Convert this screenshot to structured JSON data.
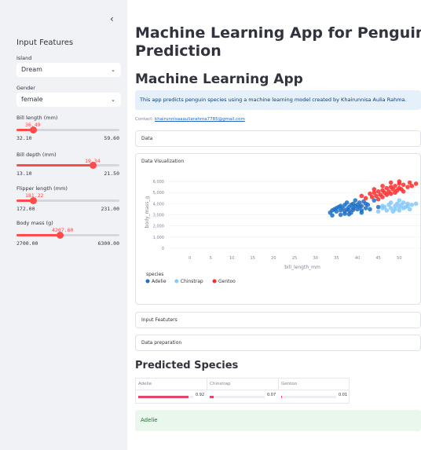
{
  "sidebar": {
    "collapse_glyph": "‹",
    "title": "Input Features",
    "island_label": "Island",
    "island_value": "Dream",
    "gender_label": "Gender",
    "gender_value": "female",
    "sliders": [
      {
        "label": "Bill length (mm)",
        "value": "36.49",
        "min": "32.10",
        "max": "59.60",
        "fraction": 0.16
      },
      {
        "label": "Bill depth (mm)",
        "value": "19.34",
        "min": "13.10",
        "max": "21.50",
        "fraction": 0.74
      },
      {
        "label": "Flipper length (mm)",
        "value": "181.22",
        "min": "172.00",
        "max": "231.00",
        "fraction": 0.16
      },
      {
        "label": "Body mass (g)",
        "value": "4207.60",
        "min": "2700.00",
        "max": "6300.00",
        "fraction": 0.42
      }
    ]
  },
  "main": {
    "title": "Machine Learning App for Penguin Species Prediction",
    "title_line1": "Machine Learning App for Penguin Spec",
    "title_line2": "Prediction",
    "subtitle": "Machine Learning App",
    "info_text": "This app predicts penguin species using a machine learning model created by Khairunnisa Aulia Rahma.",
    "contact_label": "Contact:",
    "contact_email": "khairunnisaaauliarahma7785@gmail.com",
    "expanders": {
      "data": "Data",
      "visualization": "Data Visualization",
      "input_features": "Input Featuters",
      "data_preparation": "Data preparation"
    },
    "predicted_heading": "Predicted Species",
    "probabilities": [
      {
        "species": "Adelie",
        "value": 0.92,
        "label": "0.92"
      },
      {
        "species": "Chinstrap",
        "value": 0.07,
        "label": "0.07"
      },
      {
        "species": "Gentoo",
        "value": 0.01,
        "label": "0.01"
      }
    ],
    "result": "Adelie"
  },
  "chart_data": {
    "type": "scatter",
    "xlabel": "bill_length_mm",
    "ylabel": "body_mass_g",
    "xlim": [
      -5,
      55
    ],
    "ylim": [
      0,
      6500
    ],
    "x_ticks": [
      "0",
      "5",
      "10",
      "15",
      "20",
      "25",
      "30",
      "35",
      "40",
      "45",
      "50"
    ],
    "y_ticks": [
      "0",
      "1,000",
      "2,000",
      "3,000",
      "4,000",
      "5,000",
      "6,000"
    ],
    "grid": true,
    "legend_title": "species",
    "legend_position": "bottom-left",
    "series": [
      {
        "name": "Adelie",
        "color": "#1f6fc5",
        "points": [
          [
            33.5,
            3200
          ],
          [
            34,
            3400
          ],
          [
            34.5,
            3500
          ],
          [
            35,
            3300
          ],
          [
            35,
            3600
          ],
          [
            35.5,
            3700
          ],
          [
            36,
            3400
          ],
          [
            36,
            3800
          ],
          [
            36.5,
            3600
          ],
          [
            37,
            3300
          ],
          [
            37,
            3900
          ],
          [
            37.5,
            3500
          ],
          [
            37.5,
            4100
          ],
          [
            38,
            3700
          ],
          [
            38,
            3400
          ],
          [
            38.5,
            3900
          ],
          [
            38.5,
            3200
          ],
          [
            39,
            3600
          ],
          [
            39,
            4000
          ],
          [
            39,
            3450
          ],
          [
            39.5,
            3800
          ],
          [
            39.5,
            4300
          ],
          [
            40,
            3500
          ],
          [
            40,
            3900
          ],
          [
            40.5,
            3700
          ],
          [
            40.5,
            4100
          ],
          [
            41,
            3400
          ],
          [
            41,
            3800
          ],
          [
            41.5,
            4200
          ],
          [
            42,
            3600
          ],
          [
            42,
            4000
          ],
          [
            42.5,
            3900
          ],
          [
            43,
            3500
          ],
          [
            44,
            4300
          ],
          [
            45,
            3700
          ],
          [
            36,
            3000
          ],
          [
            37,
            3100
          ],
          [
            34,
            2950
          ],
          [
            38,
            3050
          ],
          [
            41,
            3200
          ]
        ]
      },
      {
        "name": "Chinstrap",
        "color": "#83c9ff",
        "points": [
          [
            45,
            3300
          ],
          [
            46,
            3600
          ],
          [
            46.5,
            3700
          ],
          [
            47,
            3400
          ],
          [
            47.5,
            3900
          ],
          [
            48,
            3600
          ],
          [
            48.5,
            3300
          ],
          [
            49,
            3800
          ],
          [
            49,
            3500
          ],
          [
            49.5,
            4000
          ],
          [
            50,
            3700
          ],
          [
            50,
            3400
          ],
          [
            50.5,
            3900
          ],
          [
            51,
            3600
          ],
          [
            51,
            4100
          ],
          [
            51.5,
            3700
          ],
          [
            52,
            3800
          ],
          [
            52,
            4000
          ],
          [
            52.5,
            3500
          ],
          [
            53,
            3900
          ],
          [
            54,
            4000
          ],
          [
            55,
            3700
          ],
          [
            46,
            3800
          ],
          [
            48,
            4100
          ],
          [
            50,
            4300
          ]
        ]
      },
      {
        "name": "Gentoo",
        "color": "#ff2b2b",
        "points": [
          [
            41,
            4700
          ],
          [
            42,
            4500
          ],
          [
            43,
            4900
          ],
          [
            43.5,
            4600
          ],
          [
            44,
            5000
          ],
          [
            44.5,
            4700
          ],
          [
            45,
            5100
          ],
          [
            45,
            4400
          ],
          [
            45.5,
            4800
          ],
          [
            46,
            5200
          ],
          [
            46,
            4600
          ],
          [
            46.5,
            5000
          ],
          [
            47,
            5400
          ],
          [
            47,
            4800
          ],
          [
            47.5,
            5100
          ],
          [
            48,
            5500
          ],
          [
            48,
            4900
          ],
          [
            48.5,
            5300
          ],
          [
            49,
            5000
          ],
          [
            49,
            5600
          ],
          [
            49.5,
            5200
          ],
          [
            50,
            5400
          ],
          [
            50,
            5800
          ],
          [
            50.5,
            5300
          ],
          [
            51,
            5700
          ],
          [
            51,
            5100
          ],
          [
            52,
            5500
          ],
          [
            52.5,
            5900
          ],
          [
            53,
            5600
          ],
          [
            54,
            5800
          ],
          [
            55,
            5700
          ],
          [
            44,
            5300
          ],
          [
            46,
            5600
          ],
          [
            48,
            5900
          ],
          [
            50,
            6000
          ]
        ]
      }
    ]
  }
}
